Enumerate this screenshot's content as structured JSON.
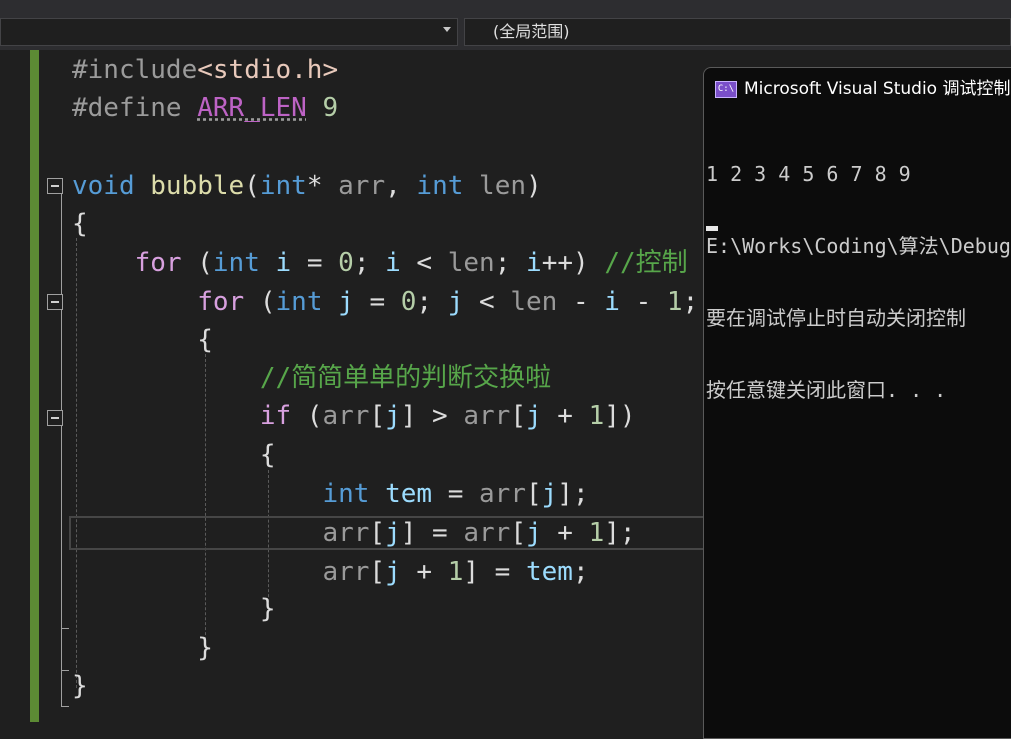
{
  "navbar": {
    "left_dropdown_value": "",
    "right_dropdown_value": "(全局范围)"
  },
  "code": {
    "lines": [
      {
        "tokens": [
          {
            "t": "#include",
            "c": "pp"
          },
          {
            "t": "<stdio.h>",
            "c": "str"
          }
        ]
      },
      {
        "tokens": [
          {
            "t": "#define ",
            "c": "pp"
          },
          {
            "t": "ARR_LEN",
            "c": "mac"
          },
          {
            "t": " ",
            "c": "pl"
          },
          {
            "t": "9",
            "c": "num"
          }
        ]
      },
      {
        "tokens": []
      },
      {
        "tokens": [
          {
            "t": "void",
            "c": "kw"
          },
          {
            "t": " ",
            "c": "pl"
          },
          {
            "t": "bubble",
            "c": "fn"
          },
          {
            "t": "(",
            "c": "pl"
          },
          {
            "t": "int",
            "c": "kw"
          },
          {
            "t": "* ",
            "c": "pl"
          },
          {
            "t": "arr",
            "c": "par"
          },
          {
            "t": ", ",
            "c": "pl"
          },
          {
            "t": "int",
            "c": "kw"
          },
          {
            "t": " ",
            "c": "pl"
          },
          {
            "t": "len",
            "c": "par"
          },
          {
            "t": ")",
            "c": "pl"
          }
        ]
      },
      {
        "tokens": [
          {
            "t": "{",
            "c": "pl"
          }
        ]
      },
      {
        "tokens": [
          {
            "t": "    ",
            "c": "pl"
          },
          {
            "t": "for",
            "c": "ctl"
          },
          {
            "t": " (",
            "c": "pl"
          },
          {
            "t": "int",
            "c": "kw"
          },
          {
            "t": " ",
            "c": "pl"
          },
          {
            "t": "i",
            "c": "var"
          },
          {
            "t": " = ",
            "c": "pl"
          },
          {
            "t": "0",
            "c": "num"
          },
          {
            "t": "; ",
            "c": "pl"
          },
          {
            "t": "i",
            "c": "var"
          },
          {
            "t": " < ",
            "c": "pl"
          },
          {
            "t": "len",
            "c": "par"
          },
          {
            "t": "; ",
            "c": "pl"
          },
          {
            "t": "i",
            "c": "var"
          },
          {
            "t": "++) ",
            "c": "pl"
          },
          {
            "t": "//控制",
            "c": "cm"
          }
        ]
      },
      {
        "tokens": [
          {
            "t": "        ",
            "c": "pl"
          },
          {
            "t": "for",
            "c": "ctl"
          },
          {
            "t": " (",
            "c": "pl"
          },
          {
            "t": "int",
            "c": "kw"
          },
          {
            "t": " ",
            "c": "pl"
          },
          {
            "t": "j",
            "c": "var"
          },
          {
            "t": " = ",
            "c": "pl"
          },
          {
            "t": "0",
            "c": "num"
          },
          {
            "t": "; ",
            "c": "pl"
          },
          {
            "t": "j",
            "c": "var"
          },
          {
            "t": " < ",
            "c": "pl"
          },
          {
            "t": "len",
            "c": "par"
          },
          {
            "t": " - ",
            "c": "pl"
          },
          {
            "t": "i",
            "c": "var"
          },
          {
            "t": " - ",
            "c": "pl"
          },
          {
            "t": "1",
            "c": "num"
          },
          {
            "t": ";",
            "c": "pl"
          }
        ]
      },
      {
        "tokens": [
          {
            "t": "        {",
            "c": "pl"
          }
        ]
      },
      {
        "tokens": [
          {
            "t": "            ",
            "c": "pl"
          },
          {
            "t": "//简简单单的判断交换啦",
            "c": "cm"
          }
        ]
      },
      {
        "tokens": [
          {
            "t": "            ",
            "c": "pl"
          },
          {
            "t": "if",
            "c": "ctl"
          },
          {
            "t": " (",
            "c": "pl"
          },
          {
            "t": "arr",
            "c": "par"
          },
          {
            "t": "[",
            "c": "pl"
          },
          {
            "t": "j",
            "c": "var"
          },
          {
            "t": "] > ",
            "c": "pl"
          },
          {
            "t": "arr",
            "c": "par"
          },
          {
            "t": "[",
            "c": "pl"
          },
          {
            "t": "j",
            "c": "var"
          },
          {
            "t": " + ",
            "c": "pl"
          },
          {
            "t": "1",
            "c": "num"
          },
          {
            "t": "])",
            "c": "pl"
          }
        ]
      },
      {
        "tokens": [
          {
            "t": "            {",
            "c": "pl"
          }
        ]
      },
      {
        "tokens": [
          {
            "t": "                ",
            "c": "pl"
          },
          {
            "t": "int",
            "c": "kw"
          },
          {
            "t": " ",
            "c": "pl"
          },
          {
            "t": "tem",
            "c": "var"
          },
          {
            "t": " = ",
            "c": "pl"
          },
          {
            "t": "arr",
            "c": "par"
          },
          {
            "t": "[",
            "c": "pl"
          },
          {
            "t": "j",
            "c": "var"
          },
          {
            "t": "];",
            "c": "pl"
          }
        ]
      },
      {
        "tokens": [
          {
            "t": "                ",
            "c": "pl"
          },
          {
            "t": "arr",
            "c": "par"
          },
          {
            "t": "[",
            "c": "pl"
          },
          {
            "t": "j",
            "c": "var"
          },
          {
            "t": "] = ",
            "c": "pl"
          },
          {
            "t": "arr",
            "c": "par"
          },
          {
            "t": "[",
            "c": "pl"
          },
          {
            "t": "j",
            "c": "var"
          },
          {
            "t": " + ",
            "c": "pl"
          },
          {
            "t": "1",
            "c": "num"
          },
          {
            "t": "];",
            "c": "pl"
          }
        ]
      },
      {
        "tokens": [
          {
            "t": "                ",
            "c": "pl"
          },
          {
            "t": "arr",
            "c": "par"
          },
          {
            "t": "[",
            "c": "pl"
          },
          {
            "t": "j",
            "c": "var"
          },
          {
            "t": " + ",
            "c": "pl"
          },
          {
            "t": "1",
            "c": "num"
          },
          {
            "t": "] = ",
            "c": "pl"
          },
          {
            "t": "tem",
            "c": "var"
          },
          {
            "t": ";",
            "c": "pl"
          }
        ]
      },
      {
        "tokens": [
          {
            "t": "            }",
            "c": "pl"
          }
        ]
      },
      {
        "tokens": [
          {
            "t": "        }",
            "c": "pl"
          }
        ]
      },
      {
        "tokens": [
          {
            "t": "}",
            "c": "pl"
          }
        ]
      }
    ]
  },
  "console": {
    "title": "Microsoft Visual Studio 调试控制台",
    "icon_label": "C:\\",
    "output_lines": [
      "1 2 3 4 5 6 7 8 9",
      "E:\\Works\\Coding\\算法\\Debug",
      "要在调试停止时自动关闭控制",
      "按任意键关闭此窗口. . ."
    ]
  },
  "colors": {
    "keyword": "#569cd6",
    "control": "#d8a0df",
    "function": "#dcdcaa",
    "variable": "#9cdcfe",
    "comment": "#57a64a",
    "number": "#b5cea8",
    "include_path": "#e8c9bb",
    "change_bar": "#5c8a34"
  }
}
